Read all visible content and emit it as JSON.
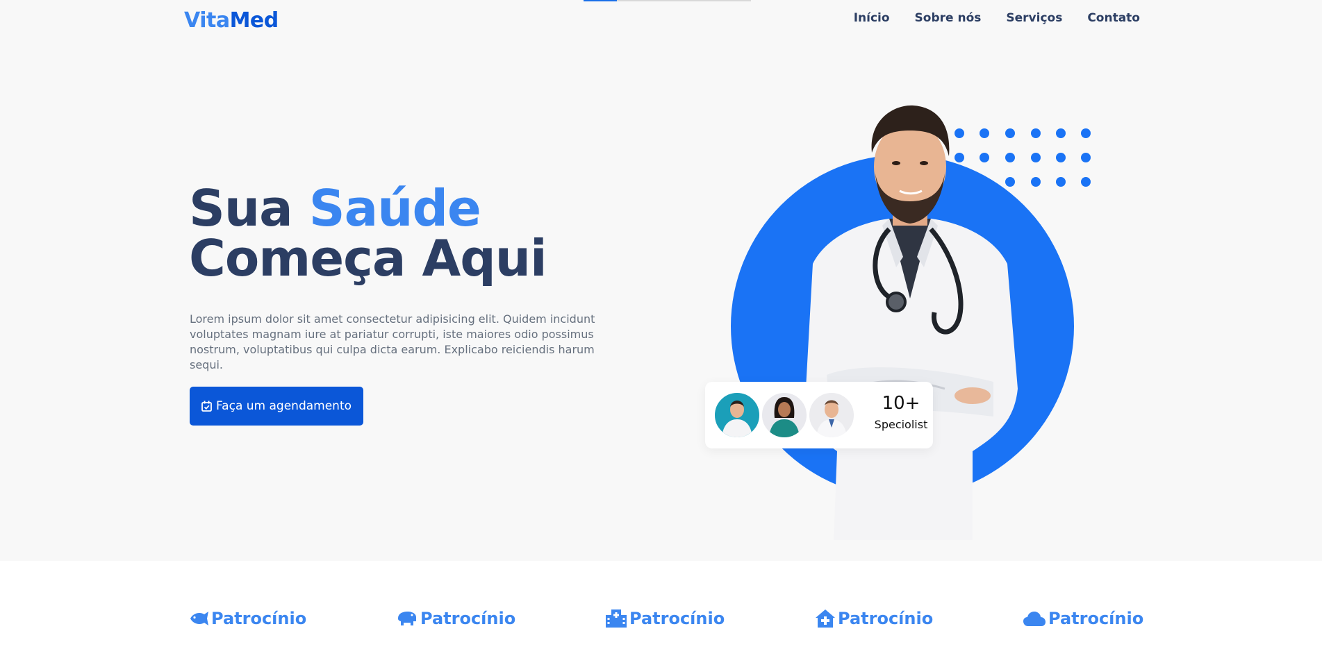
{
  "header": {
    "logo_part1": "Vita",
    "logo_part2": "Med",
    "nav": [
      "Início",
      "Sobre nós",
      "Serviços",
      "Contato"
    ]
  },
  "hero": {
    "headline_line1_a": "Sua ",
    "headline_line1_b": "Saúde",
    "headline_line2": "Começa Aqui",
    "description": "Lorem ipsum dolor sit amet consectetur adipisicing elit. Quidem incidunt voluptates magnam iure at pariatur corrupti, iste maiores odio possimus nostrum, voluptatibus qui culpa dicta earum. Explicabo reiciendis harum sequi.",
    "cta_label": "Faça um agendamento",
    "cta_icon": "calendar-check-icon"
  },
  "specialists": {
    "count": "10+",
    "label": "Speciolist"
  },
  "sponsors": [
    {
      "label": "Patrocínio",
      "icon": "fish-icon"
    },
    {
      "label": "Patrocínio",
      "icon": "hippo-icon"
    },
    {
      "label": "Patrocínio",
      "icon": "hospital-icon"
    },
    {
      "label": "Patrocínio",
      "icon": "house-medical-icon"
    },
    {
      "label": "Patrocínio",
      "icon": "cloud-icon"
    }
  ],
  "colors": {
    "primary": "#0b57d8",
    "accent": "#3b86f0",
    "circle": "#1a73f5",
    "text_dark": "#2c3e63"
  }
}
